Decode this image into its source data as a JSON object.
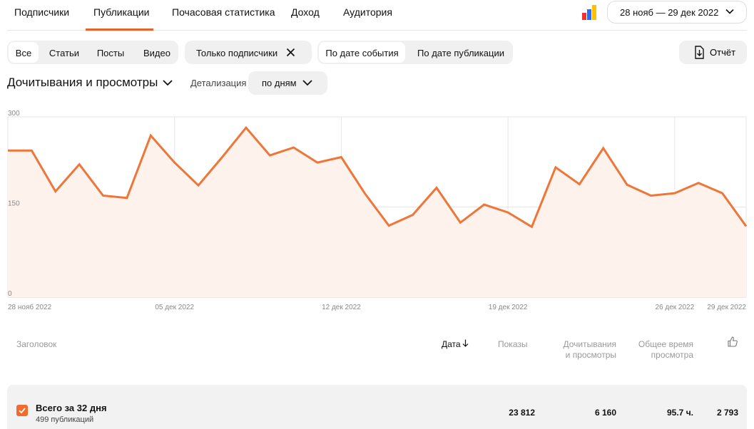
{
  "nav": {
    "tabs": [
      {
        "label": "Подписчики"
      },
      {
        "label": "Публикации"
      },
      {
        "label": "Почасовая статистика"
      },
      {
        "label": "Доход"
      },
      {
        "label": "Аудитория"
      }
    ],
    "active_tab": "Публикации",
    "date_range": "28 нояб — 29 дек 2022"
  },
  "filters": {
    "content_types": [
      "Все",
      "Статьи",
      "Посты",
      "Видео"
    ],
    "content_type_selected": "Все",
    "subscribers_only": "Только подписчики",
    "date_modes": [
      "По дате события",
      "По дате публикации"
    ],
    "date_mode_selected": "По дате события",
    "report_label": "Отчёт"
  },
  "metric": {
    "title": "Дочитывания и просмотры",
    "detail_label": "Детализация",
    "detail_value": "по дням"
  },
  "chart_data": {
    "type": "area",
    "y_ticks": [
      "300",
      "150",
      "0"
    ],
    "ylim": [
      0,
      300
    ],
    "x_tick_labels": [
      "28 нояб 2022",
      "05 дек 2022",
      "12 дек 2022",
      "19 дек 2022",
      "26 дек 2022",
      "29 дек 2022"
    ],
    "x": [
      "2022-11-28",
      "2022-11-29",
      "2022-11-30",
      "2022-12-01",
      "2022-12-02",
      "2022-12-03",
      "2022-12-04",
      "2022-12-05",
      "2022-12-06",
      "2022-12-07",
      "2022-12-08",
      "2022-12-09",
      "2022-12-10",
      "2022-12-11",
      "2022-12-12",
      "2022-12-13",
      "2022-12-14",
      "2022-12-15",
      "2022-12-16",
      "2022-12-17",
      "2022-12-18",
      "2022-12-19",
      "2022-12-20",
      "2022-12-21",
      "2022-12-22",
      "2022-12-23",
      "2022-12-24",
      "2022-12-25",
      "2022-12-26",
      "2022-12-27",
      "2022-12-28",
      "2022-12-29"
    ],
    "values": [
      244,
      244,
      176,
      221,
      169,
      165,
      269,
      224,
      186,
      233,
      282,
      236,
      249,
      224,
      233,
      172,
      119,
      137,
      182,
      124,
      154,
      141,
      117,
      216,
      188,
      248,
      187,
      169,
      173,
      190,
      173,
      118
    ],
    "line_color": "#ee7639",
    "fill_color": "#fdf2ec",
    "grid": true
  },
  "table": {
    "headers": {
      "title": "Заголовок",
      "date": "Дата",
      "date_sort_icon": "arrow-down-icon",
      "views": "Показы",
      "reads_line1": "Дочитывания",
      "reads_line2": "и просмотры",
      "time_line1": "Общее время",
      "time_line2": "просмотра",
      "likes_icon": "thumbs-up-icon"
    },
    "total": {
      "title": "Всего за 32 дня",
      "subtitle": "499 публикаций",
      "views": "23 812",
      "reads": "6 160",
      "time": "95.7 ч.",
      "likes": "2 793"
    }
  },
  "colors": {
    "accent": "#e8632b",
    "checkbox": "#f26b2b",
    "logo": [
      "#f33030",
      "#2b6cf5",
      "#ffc000"
    ]
  }
}
